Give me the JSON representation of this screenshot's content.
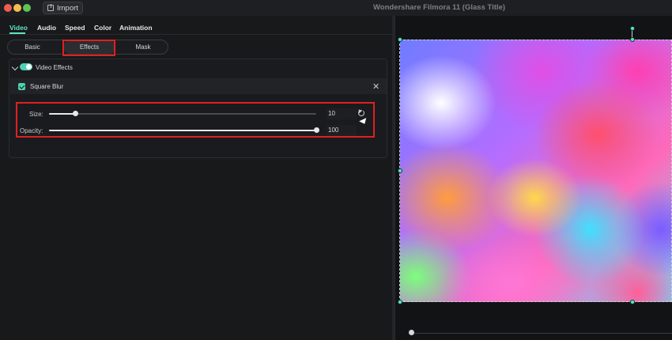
{
  "window": {
    "title": "Wondershare Filmora 11 (Glass Title)",
    "import_label": "Import"
  },
  "tabs": [
    {
      "label": "Video",
      "active": true
    },
    {
      "label": "Audio",
      "active": false
    },
    {
      "label": "Speed",
      "active": false
    },
    {
      "label": "Color",
      "active": false
    },
    {
      "label": "Animation",
      "active": false
    }
  ],
  "subtabs": [
    {
      "label": "Basic",
      "active": false
    },
    {
      "label": "Effects",
      "active": true
    },
    {
      "label": "Mask",
      "active": false
    }
  ],
  "video_effects": {
    "title": "Video Effects",
    "enabled": true,
    "effect": {
      "name": "Square Blur",
      "checked": true,
      "params": [
        {
          "label": "Size:",
          "value": "10",
          "fraction": 0.1
        },
        {
          "label": "Opacity:",
          "value": "100",
          "fraction": 1.0
        }
      ]
    }
  },
  "colors": {
    "accent": "#5fe3c4",
    "highlight": "#e02020",
    "background": "#18191b"
  }
}
